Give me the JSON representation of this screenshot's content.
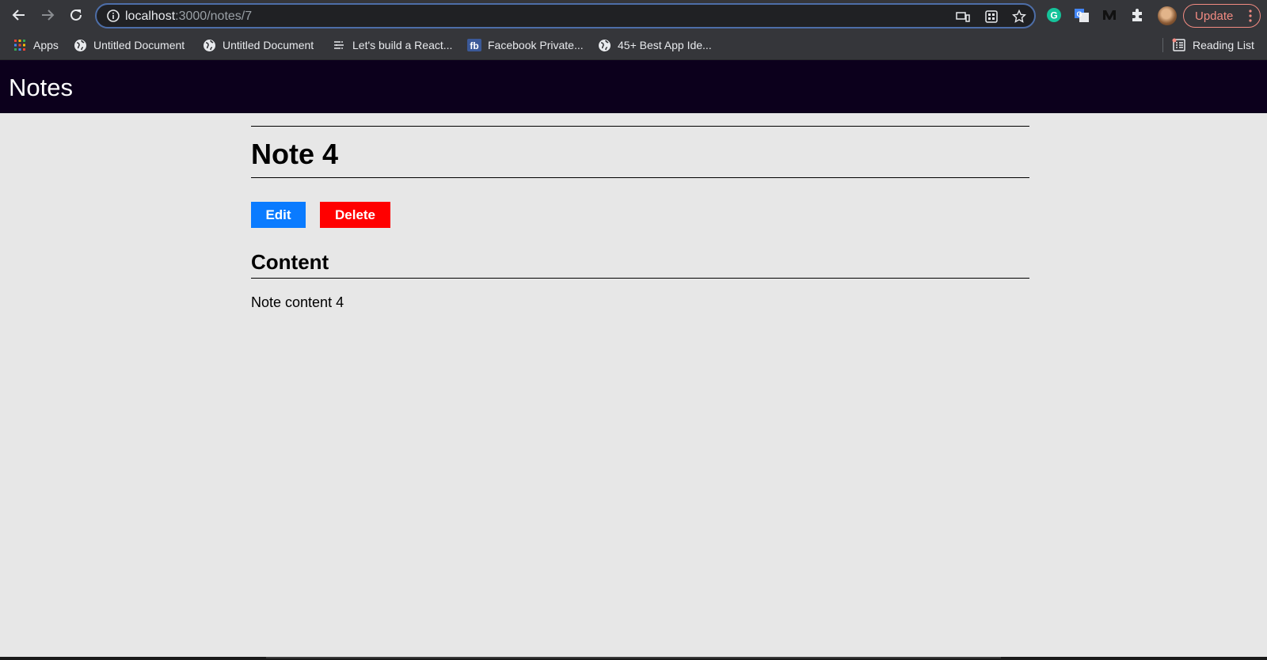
{
  "browser": {
    "url_host": "localhost",
    "url_path": ":3000/notes/7",
    "update_label": "Update",
    "bookmarks": [
      {
        "label": "Apps",
        "icon": "apps-grid-icon"
      },
      {
        "label": "Untitled Document",
        "icon": "globe-icon"
      },
      {
        "label": "Untitled Document",
        "icon": "globe-icon"
      },
      {
        "label": "Let's build a React...",
        "icon": "list-icon"
      },
      {
        "label": "Facebook Private...",
        "icon": "fb-icon"
      },
      {
        "label": "45+ Best App Ide...",
        "icon": "globe-icon"
      }
    ],
    "reading_list_label": "Reading List"
  },
  "app": {
    "title": "Notes"
  },
  "note": {
    "title": "Note 4",
    "edit_label": "Edit",
    "delete_label": "Delete",
    "section_title": "Content",
    "body": "Note content 4"
  },
  "colors": {
    "header_bg": "#0c001c",
    "page_bg": "#e7e7e7",
    "edit_button": "#0a7bff",
    "delete_button": "#ff0000"
  }
}
